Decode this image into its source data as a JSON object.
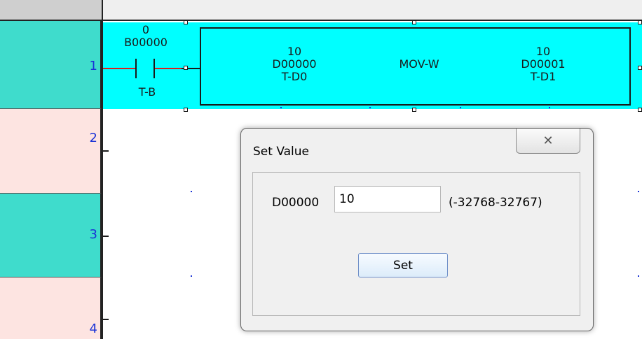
{
  "rows": [
    {
      "number": "1",
      "color": "#3fdccc"
    },
    {
      "number": "2",
      "color": "#fde4e1"
    },
    {
      "number": "3",
      "color": "#3fdccc"
    },
    {
      "number": "4",
      "color": "#fde4e1"
    }
  ],
  "contact": {
    "value": "0",
    "address": "B00000",
    "comment": "T-B"
  },
  "instruction": {
    "source_value": "10",
    "source_address": "D00000",
    "source_comment": "T-D0",
    "mnemonic": "MOV-W",
    "dest_value": "10",
    "dest_address": "D00001",
    "dest_comment": "T-D1"
  },
  "dialog": {
    "title": "Set Value",
    "close_glyph": "✕",
    "device_label": "D00000",
    "input_value": "10",
    "range": "(-32768-32767)",
    "set_button": "Set"
  },
  "colors": {
    "rung_highlight": "#00ffff",
    "row_teal": "#3fdccc",
    "row_pink": "#fde4e1",
    "contact_line": "#d92020",
    "row_number": "#1a33d6"
  }
}
